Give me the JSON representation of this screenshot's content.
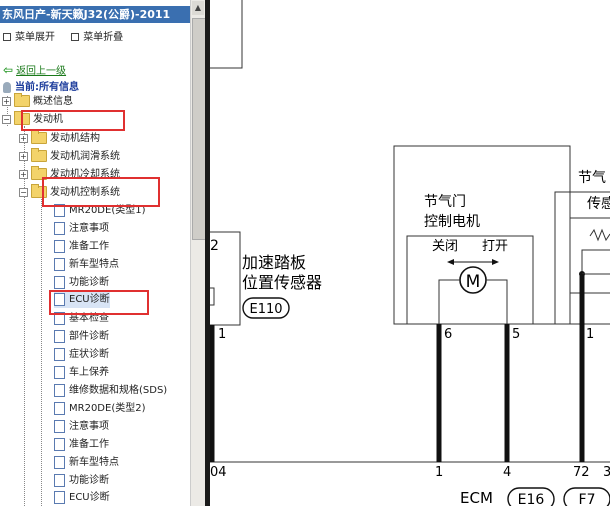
{
  "window_title": "东风日产-新天籁J32(公爵)-2011",
  "menu": {
    "expand": "菜单展开",
    "collapse": "菜单折叠"
  },
  "nav": {
    "back": "返回上一级",
    "current": "当前:所有信息"
  },
  "tree": [
    {
      "label": "概述信息"
    },
    {
      "label": "发动机"
    },
    {
      "label": "发动机结构"
    },
    {
      "label": "发动机润滑系统"
    },
    {
      "label": "发动机冷却系统"
    },
    {
      "label": "发动机控制系统"
    },
    {
      "label": "MR20DE(类型1)"
    },
    {
      "label": "注意事项"
    },
    {
      "label": "准备工作"
    },
    {
      "label": "新车型特点"
    },
    {
      "label": "功能诊断"
    },
    {
      "label": "ECU诊断"
    },
    {
      "label": "基本检查"
    },
    {
      "label": "部件诊断"
    },
    {
      "label": "症状诊断"
    },
    {
      "label": "车上保养"
    },
    {
      "label": "维修数据和规格(SDS)"
    },
    {
      "label": "MR20DE(类型2)"
    },
    {
      "label": "注意事项"
    },
    {
      "label": "准备工作"
    },
    {
      "label": "新车型特点"
    },
    {
      "label": "功能诊断"
    },
    {
      "label": "ECU诊断"
    }
  ],
  "diagram": {
    "pedal_sensor": {
      "line1": "加速踏板",
      "line2": "位置传感器",
      "connector": "E110",
      "pin": "1",
      "bottom_pin": "04"
    },
    "throttle_motor": {
      "line1": "节气门",
      "line2": "控制电机",
      "close": "关闭",
      "open": "打开",
      "motor": "M",
      "pin_left": "6",
      "pin_right": "5",
      "ecm_pin_left": "1",
      "ecm_pin_right": "4"
    },
    "throttle_sensor": {
      "line1": "节气",
      "line2": "传感",
      "pin": "1",
      "ecm_pin": "72",
      "ecm_pin2": "3"
    },
    "ecm": {
      "label": "ECM",
      "conn1": "E16",
      "conn2": "F7"
    }
  }
}
